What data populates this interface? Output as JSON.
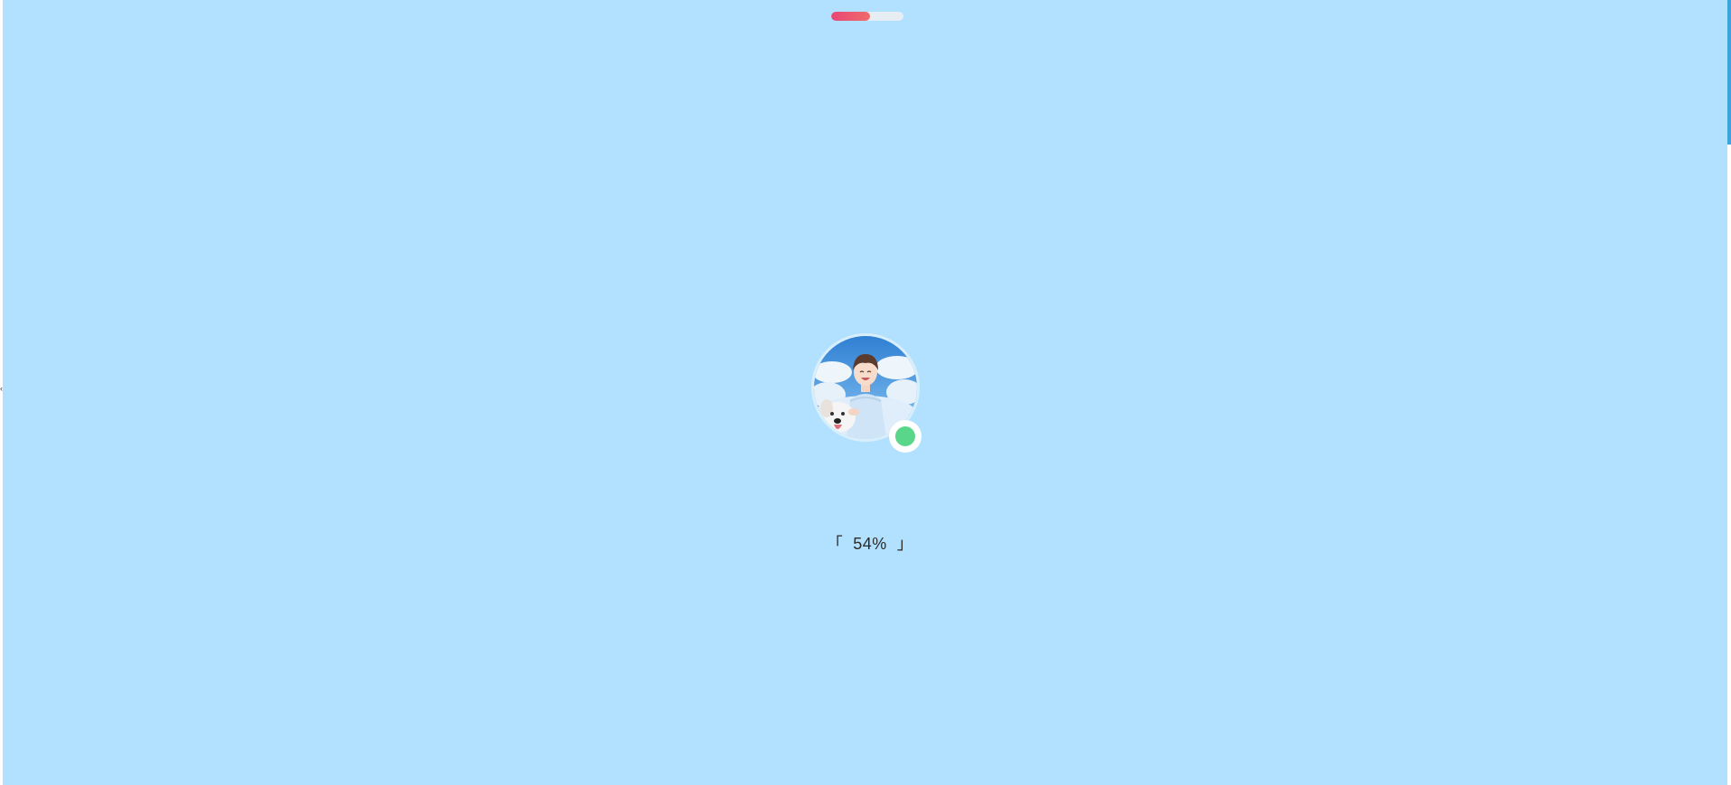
{
  "loader": {
    "top_progress_fraction": 0.54,
    "percent_text": "「  54%  」",
    "status": "online"
  },
  "colors": {
    "background": "#b1e1fe",
    "progress_fill_start": "#e84676",
    "progress_fill_end": "#ef6c6c",
    "progress_track": "#e6eef4",
    "status_dot": "#5ad68a",
    "scrollbar_thumb": "#3da3dd"
  },
  "avatar": {
    "icon": "avatar-illustration"
  }
}
